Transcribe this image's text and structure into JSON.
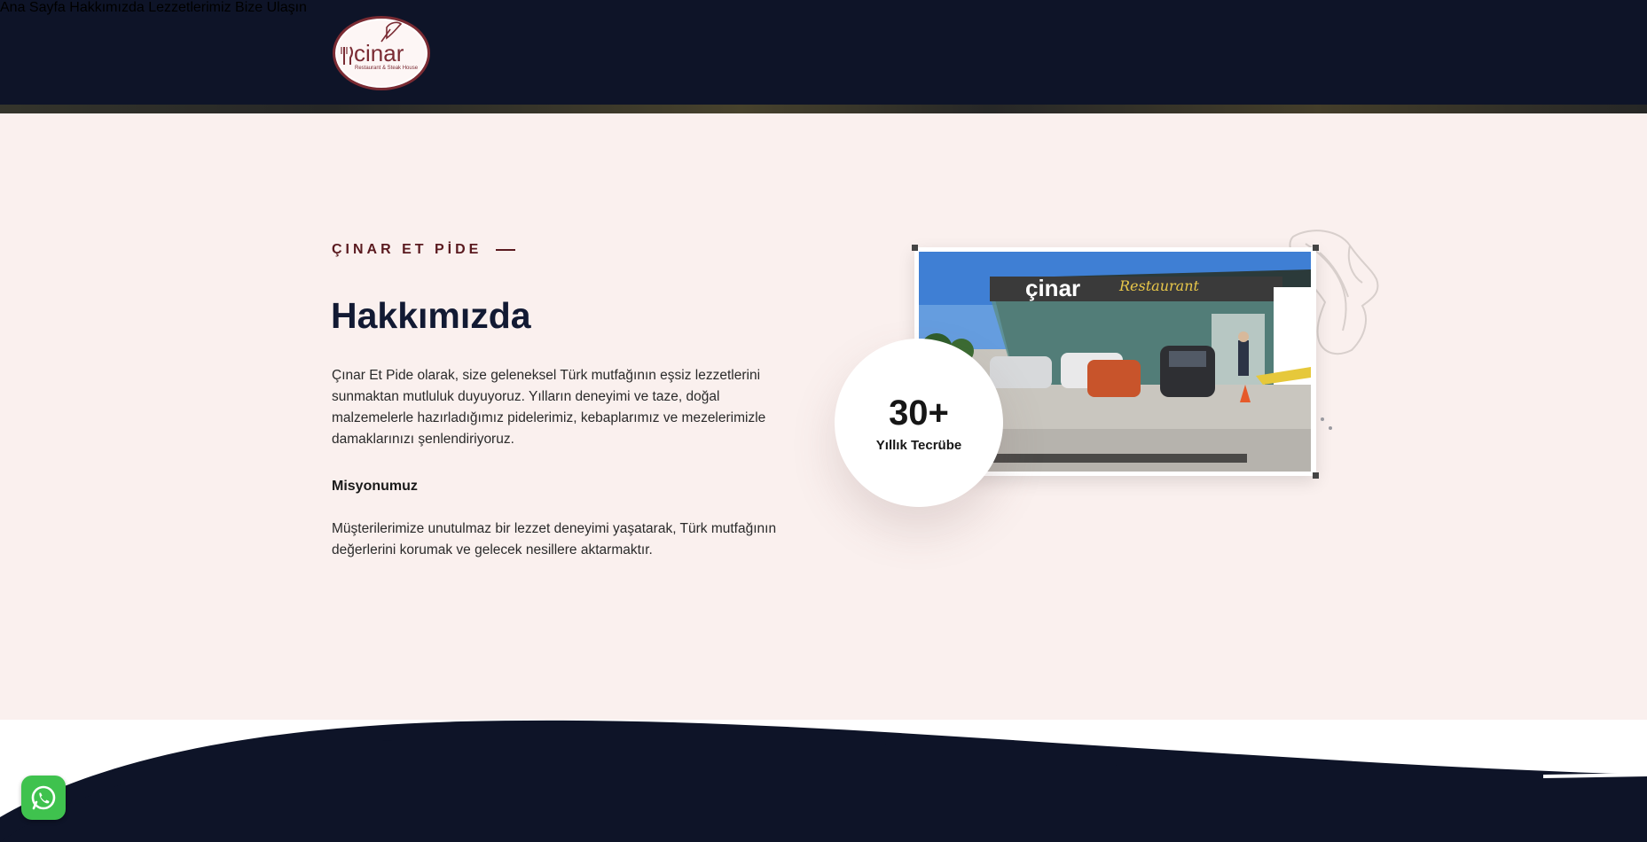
{
  "brand": {
    "logo_word": "cinar",
    "logo_tagline": "Restaurant & Steak House"
  },
  "nav": {
    "items": [
      {
        "label": "Ana Sayfa"
      },
      {
        "label": "Hakkımızda"
      },
      {
        "label": "Lezzetlerimiz"
      },
      {
        "label": "Bize Ulaşın"
      }
    ]
  },
  "about": {
    "eyebrow": "ÇINAR ET PİDE",
    "title": "Hakkımızda",
    "intro": "Çınar Et Pide olarak, size geleneksel Türk mutfağının eşsiz lezzetlerini sunmaktan mutluluk duyuyoruz. Yılların deneyimi ve taze, doğal malzemelerle hazırladığımız pidelerimiz, kebaplarımız ve mezelerimizle damaklarınızı şenlendiriyoruz.",
    "mission_title": "Misyonumuz",
    "mission_text": "Müşterilerimize unutulmaz bir lezzet deneyimi yaşatarak, Türk mutfağının değerlerini korumak ve gelecek nesillere aktarmaktır."
  },
  "experience": {
    "number": "30+",
    "label": "Yıllık Tecrübe"
  },
  "photo": {
    "sign_brand": "çinar",
    "sign_script": "Restaurant"
  },
  "colors": {
    "navy": "#0e1428",
    "accent": "#5a1a1f",
    "section_bg": "#faf0ee",
    "whatsapp": "#3fc24e"
  },
  "icons": {
    "whatsapp": "whatsapp-icon",
    "leaf": "leaf-decoration-icon"
  }
}
